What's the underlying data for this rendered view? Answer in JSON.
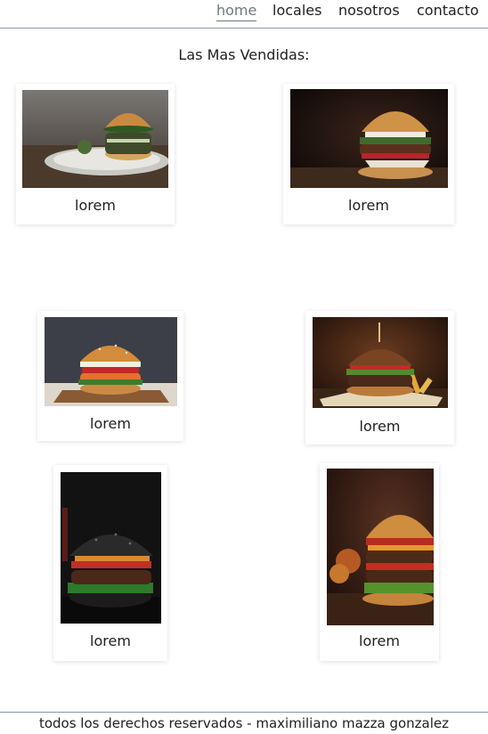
{
  "nav": {
    "items": [
      {
        "label": "home",
        "active": true
      },
      {
        "label": "locales",
        "active": false
      },
      {
        "label": "nosotros",
        "active": false
      },
      {
        "label": "contacto",
        "active": false
      }
    ]
  },
  "main": {
    "title": "Las Mas Vendidas:",
    "products": [
      {
        "caption": "lorem",
        "image": "burger-photo-plate"
      },
      {
        "caption": "lorem",
        "image": "burger-photo-dark"
      },
      {
        "caption": "lorem",
        "image": "burger-photo-crispy"
      },
      {
        "caption": "lorem",
        "image": "burger-photo-fries"
      },
      {
        "caption": "lorem",
        "image": "burger-photo-black-bun"
      },
      {
        "caption": "lorem",
        "image": "burger-photo-double"
      }
    ]
  },
  "footer": {
    "text": "todos los derechos reservados - maximiliano mazza gonzalez"
  },
  "colors": {
    "rule": "#8a97a4",
    "active_link": "#6f7882",
    "text": "#1f1f1f"
  }
}
